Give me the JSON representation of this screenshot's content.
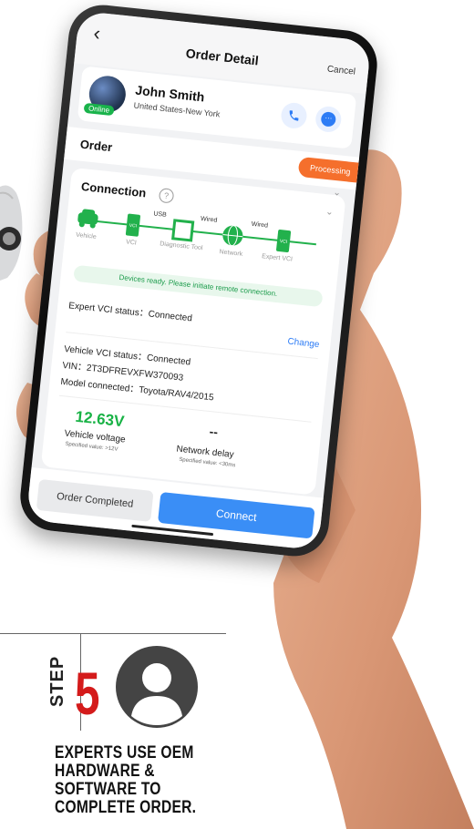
{
  "screen": {
    "title": "Order Detail",
    "cancel_label": "Cancel",
    "customer": {
      "name": "John Smith",
      "location": "United States-New York",
      "status_badge": "Online"
    },
    "order": {
      "label": "Order",
      "status": "Processing",
      "status_color": "#f56f2c"
    },
    "connection": {
      "title": "Connection",
      "help_icon": "?",
      "nodes": [
        "Vehicle",
        "VCI",
        "Diagnostic Tool",
        "Network",
        "Expert VCI"
      ],
      "links": [
        "USB",
        "Wired",
        "Wired"
      ],
      "vci_chip_label": "VCI",
      "ready_message": "Devices ready. Please initiate remote connection.",
      "expert_vci_status": "Expert VCI status：Connected",
      "change_label": "Change",
      "vehicle_vci_status": "Vehicle VCI status：Connected",
      "vin": "VIN：2T3DFREVXFW370093",
      "model": "Model connected：Toyota/RAV4/2015",
      "voltage_value": "12.63V",
      "voltage_label": "Vehicle voltage",
      "voltage_spec": "Specified value: >12V",
      "delay_value": "--",
      "delay_label": "Network delay",
      "delay_spec": "Specified value: <30ms",
      "accent_color": "#18b245"
    },
    "buttons": {
      "completed": "Order Completed",
      "connect": "Connect",
      "connect_color": "#3a8ef6"
    }
  },
  "step": {
    "word": "STEP",
    "number": "5",
    "number_color": "#d41b1b",
    "icon": "person-icon",
    "description": "EXPERTS USE OEM HARDWARE & SOFTWARE TO COMPLETE ORDER."
  }
}
